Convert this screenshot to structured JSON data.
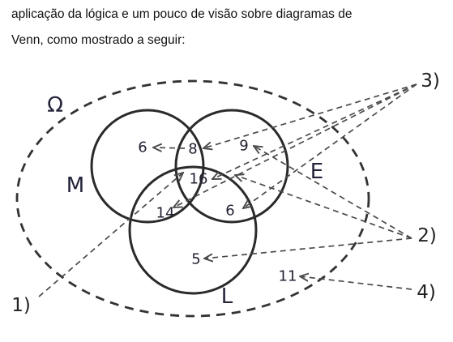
{
  "intro": {
    "line1": "aplicação da lógica e um pouco de visão sobre diagramas de",
    "line2": "Venn, como mostrado a seguir:"
  },
  "diagram": {
    "universe_label": "Ω",
    "sets": {
      "M": "M",
      "E": "E",
      "L": "L"
    },
    "regions": {
      "only_m": "6",
      "m_and_e": "8",
      "only_e": "9",
      "m_e_and_l": "16",
      "m_and_l": "14",
      "e_and_l": "6",
      "only_l": "5",
      "outside": "11"
    },
    "callouts": {
      "c1": "1)",
      "c2": "2)",
      "c3": "3)",
      "c4": "4)"
    }
  }
}
